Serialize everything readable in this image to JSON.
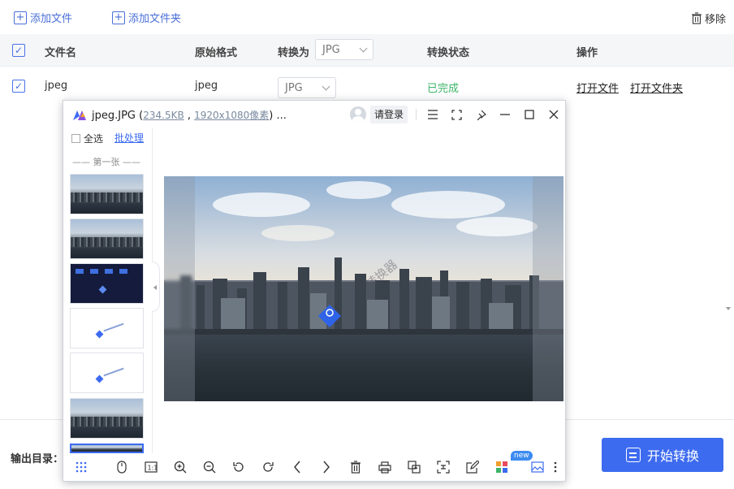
{
  "toolbar": {
    "add_file": "添加文件",
    "add_folder": "添加文件夹",
    "remove": "移除"
  },
  "table": {
    "headers": {
      "filename": "文件名",
      "original_format": "原始格式",
      "convert_to": "转换为",
      "convert_to_value": "JPG",
      "status": "转换状态",
      "actions": "操作"
    },
    "rows": [
      {
        "filename": "jpeg",
        "original_format": "jpeg",
        "target_format": "JPG",
        "status": "已完成",
        "open_file": "打开文件",
        "open_folder": "打开文件夹"
      }
    ]
  },
  "bottom": {
    "output_label": "输出目录：",
    "start_button": "开始转换"
  },
  "viewer": {
    "file_name": "jpeg.JPG",
    "file_size": "234.5KB",
    "resolution": "1920x1080像素",
    "title_suffix": ") ...",
    "login": "请登录",
    "select_all": "全选",
    "batch": "批处理",
    "group_label": "—— 第一张 ——",
    "watermark": "转换器",
    "new_badge": "new"
  },
  "colors": {
    "accent": "#3d6bf0",
    "link": "#4a6fd8",
    "status_done": "#3db56a",
    "header_bg": "#f5f6f8"
  }
}
